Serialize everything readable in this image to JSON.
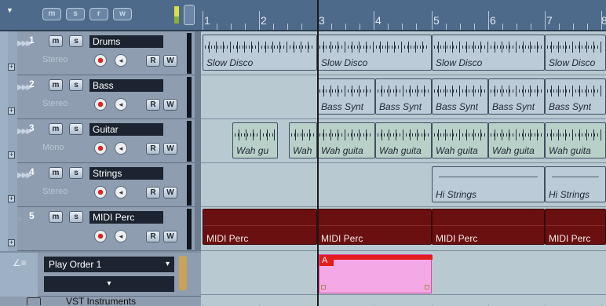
{
  "header": {
    "filters": [
      "m",
      "s",
      "r",
      "w"
    ]
  },
  "tracks": [
    {
      "number": "1",
      "name": "Drums",
      "type": "Stereo"
    },
    {
      "number": "2",
      "name": "Bass",
      "type": "Stereo"
    },
    {
      "number": "3",
      "name": "Guitar",
      "type": "Mono"
    },
    {
      "number": "4",
      "name": "Strings",
      "type": "Stereo"
    },
    {
      "number": "5",
      "name": "MIDI Perc",
      "type": ""
    }
  ],
  "buttons": {
    "mute": "m",
    "solo": "s",
    "read": "R",
    "write": "W"
  },
  "play_order": {
    "selected": "Play Order 1",
    "caret": "▾"
  },
  "folder": {
    "name": "VST Instruments"
  },
  "ruler": {
    "numbers": [
      "1",
      "2",
      "3",
      "4",
      "5",
      "6",
      "7",
      "8"
    ]
  },
  "parts": {
    "drums": [
      "Slow Disco",
      "Slow Disco",
      "Slow Disco",
      "Slow Disco"
    ],
    "bass": [
      "Bass Synt",
      "Bass Synt",
      "Bass Synt",
      "Bass Synt",
      "Bass Synt"
    ],
    "guitar": [
      "Wah gu",
      "Wah",
      "Wah guita",
      "Wah guita",
      "Wah guita",
      "Wah guita",
      "Wah guita"
    ],
    "strings": [
      "Hi Strings",
      "Hi Strings"
    ],
    "midi": [
      "MIDI Perc",
      "MIDI Perc",
      "MIDI Perc",
      "MIDI Perc"
    ]
  },
  "arranger_event": {
    "label": "A",
    "color": "#f5a8e6"
  },
  "colors": {
    "midi_part": "#6a1010",
    "ruler": "#4d6a8a",
    "event_flag": "#e41c1c"
  }
}
